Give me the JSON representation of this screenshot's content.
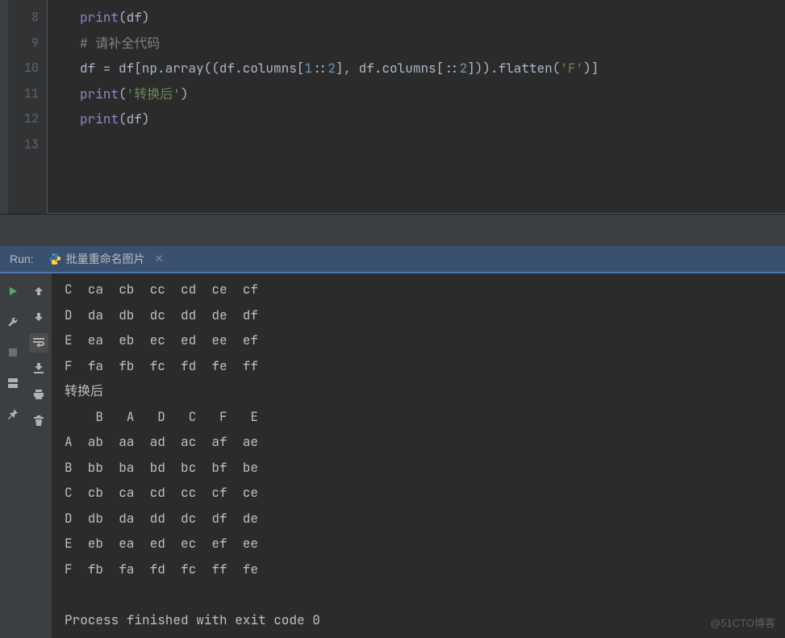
{
  "editor": {
    "gutter": [
      "8",
      "9",
      "10",
      "11",
      "12",
      "13"
    ],
    "lines": [
      {
        "tokens": [
          {
            "cls": "tk-fn",
            "t": "print"
          },
          {
            "cls": "tk-default",
            "t": "(df)"
          }
        ]
      },
      {
        "tokens": [
          {
            "cls": "tk-comment",
            "t": "# 请补全代码"
          }
        ]
      },
      {
        "tokens": [
          {
            "cls": "tk-default",
            "t": "df = df[np.array((df.columns["
          },
          {
            "cls": "tk-num",
            "t": "1"
          },
          {
            "cls": "tk-default",
            "t": "::"
          },
          {
            "cls": "tk-num",
            "t": "2"
          },
          {
            "cls": "tk-default",
            "t": "]"
          },
          {
            "cls": "tk-default",
            "t": ", "
          },
          {
            "cls": "tk-default",
            "t": "df.columns[::"
          },
          {
            "cls": "tk-num",
            "t": "2"
          },
          {
            "cls": "tk-default",
            "t": "])).flatten("
          },
          {
            "cls": "tk-str",
            "t": "'F'"
          },
          {
            "cls": "tk-default",
            "t": ")]"
          }
        ]
      },
      {
        "tokens": [
          {
            "cls": "tk-fn",
            "t": "print"
          },
          {
            "cls": "tk-default",
            "t": "("
          },
          {
            "cls": "tk-str",
            "t": "'转换后'"
          },
          {
            "cls": "tk-default",
            "t": ")"
          }
        ]
      },
      {
        "tokens": [
          {
            "cls": "tk-fn",
            "t": "print"
          },
          {
            "cls": "tk-default",
            "t": "(df)"
          }
        ]
      },
      {
        "tokens": [
          {
            "cls": "tk-default",
            "t": ""
          }
        ]
      }
    ]
  },
  "run": {
    "label": "Run:",
    "tab": "批量重命名图片",
    "console_lines": [
      "C  ca  cb  cc  cd  ce  cf",
      "D  da  db  dc  dd  de  df",
      "E  ea  eb  ec  ed  ee  ef",
      "F  fa  fb  fc  fd  fe  ff",
      "转换后",
      "    B   A   D   C   F   E",
      "A  ab  aa  ad  ac  af  ae",
      "B  bb  ba  bd  bc  bf  be",
      "C  cb  ca  cd  cc  cf  ce",
      "D  db  da  dd  dc  df  de",
      "E  eb  ea  ed  ec  ef  ee",
      "F  fb  fa  fd  fc  ff  fe",
      "",
      "Process finished with exit code 0"
    ]
  },
  "watermark": "@51CTO博客"
}
